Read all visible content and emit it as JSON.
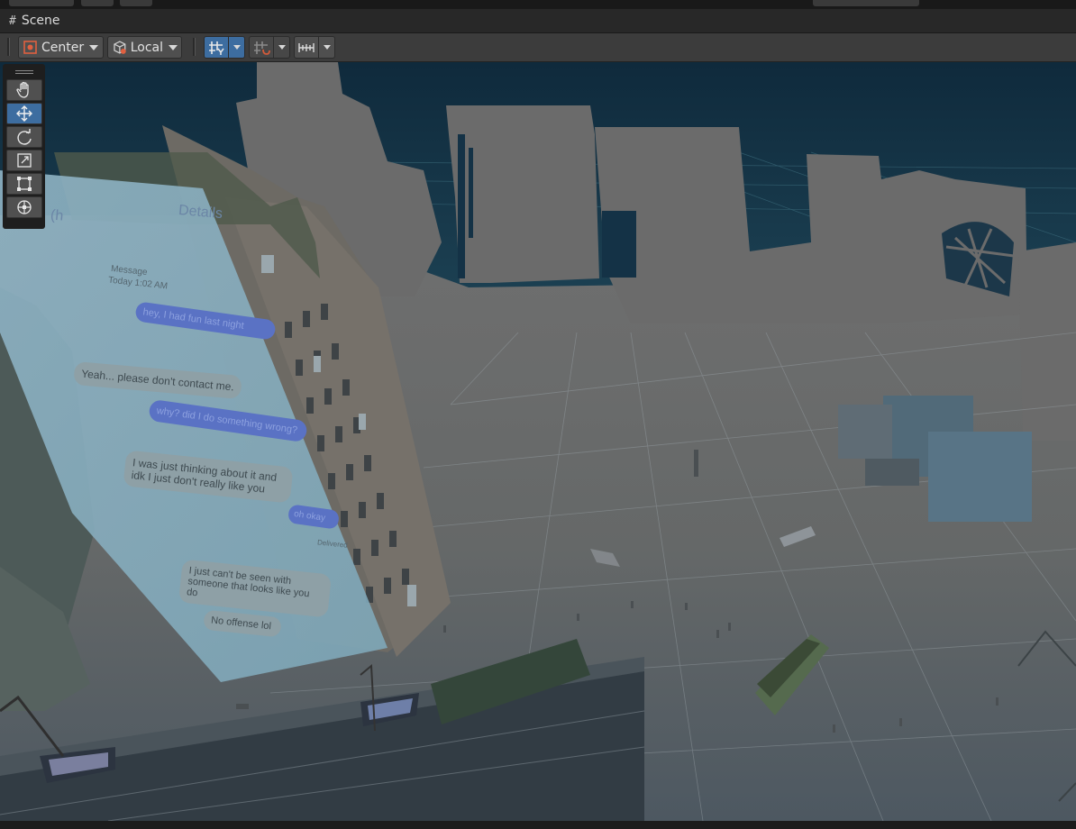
{
  "tab": {
    "icon": "#",
    "title": "Scene"
  },
  "toolbar": {
    "pivot_mode": "Center",
    "pivot_rotation": "Local",
    "icons": {
      "pivot": "pivot-center-icon",
      "rotation": "local-cube-icon",
      "grid": "grid-snap-icon",
      "snap": "snap-increment-icon",
      "ruler": "ruler-icon"
    }
  },
  "tools": [
    {
      "name": "hand-tool",
      "icon": "hand-icon",
      "active": false
    },
    {
      "name": "move-tool",
      "icon": "move-arrows-icon",
      "active": true
    },
    {
      "name": "rotate-tool",
      "icon": "rotate-icon",
      "active": false
    },
    {
      "name": "scale-tool",
      "icon": "scale-icon",
      "active": false
    },
    {
      "name": "rect-tool",
      "icon": "rect-transform-icon",
      "active": false
    },
    {
      "name": "transform-tool",
      "icon": "transform-icon",
      "active": false
    }
  ],
  "scene": {
    "sky_color": "#143246",
    "fog_color": "#6b6b6b",
    "phone_screen": {
      "header_link": "Details",
      "header_left": "(h",
      "timestamp_label": "Message",
      "timestamp": "Today 1:02 AM",
      "messages": [
        {
          "from": "me",
          "text": "hey, I had fun last night"
        },
        {
          "from": "them",
          "text": "Yeah... please don't contact me."
        },
        {
          "from": "me",
          "text": "why? did I do something wrong?"
        },
        {
          "from": "them",
          "text": "I was just thinking about it and idk I just don't really like you"
        },
        {
          "from": "me",
          "text": "oh okay"
        },
        {
          "from": "them",
          "text": "I just can't be seen with someone that looks like you do"
        },
        {
          "from": "them",
          "text": "No offense lol"
        }
      ],
      "delivered": "Delivered"
    }
  }
}
